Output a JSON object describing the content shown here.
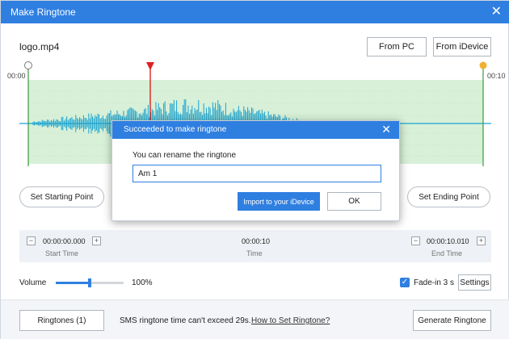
{
  "window": {
    "title": "Make Ringtone",
    "close_symbol": "✕"
  },
  "file": {
    "name": "logo.mp4"
  },
  "toolbar": {
    "from_pc_label": "From PC",
    "from_idevice_label": "From iDevice"
  },
  "timeline": {
    "start_label": "00:00",
    "end_label": "00:10"
  },
  "markers": {
    "set_start_label": "Set Starting Point",
    "set_end_label": "Set Ending Point"
  },
  "time_panel": {
    "start_value": "00:00:00.000",
    "start_label": "Start Time",
    "duration_value": "00:00:10",
    "duration_label": "Time",
    "end_value": "00:00:10.010",
    "end_label": "End Time",
    "minus": "−",
    "plus": "+"
  },
  "volume": {
    "label": "Volume",
    "value_text": "100%",
    "level": 0.5
  },
  "fade": {
    "checked": true,
    "check_symbol": "✓",
    "label": "Fade-in 3 s",
    "settings_label": "Settings"
  },
  "bottom": {
    "ringtones_label": "Ringtones (1)",
    "sms_note": "SMS ringtone time can't exceed 29s.",
    "howto_link": "How to Set Ringtone?",
    "generate_label": "Generate Ringtone"
  },
  "dialog": {
    "title": "Succeeded to make ringtone",
    "close_symbol": "✕",
    "prompt": "You can rename the ringtone",
    "input_value": "Am 1",
    "import_label": "Import to your iDevice",
    "ok_label": "OK"
  },
  "colors": {
    "accent": "#2f7fe1",
    "selection": "#d8f0d8",
    "wave": "#1aa3d0",
    "playhead": "#e02020",
    "end_marker": "#f0b030"
  }
}
